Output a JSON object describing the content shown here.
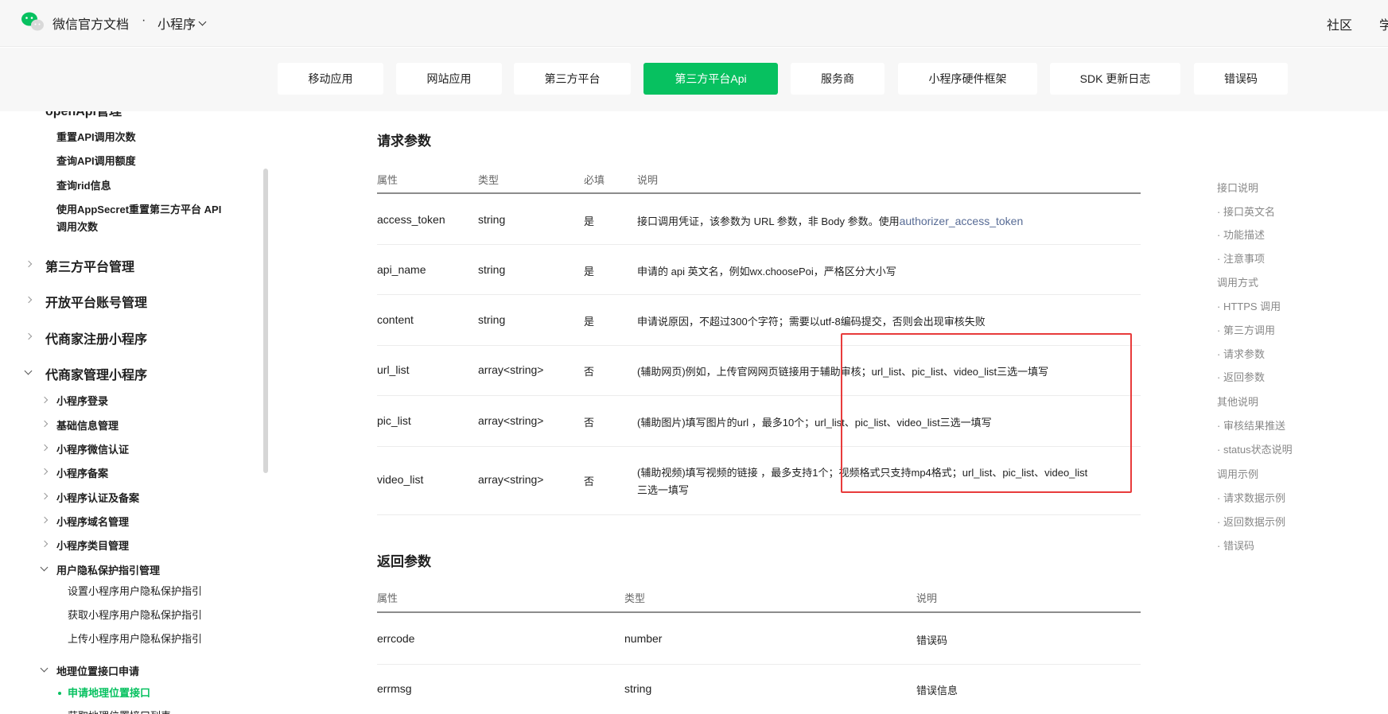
{
  "header": {
    "brand": "微信官方文档",
    "separator": "·",
    "product": "小程序",
    "right_links": [
      "社区",
      "学"
    ]
  },
  "subnav": {
    "items": [
      "移动应用",
      "网站应用",
      "第三方平台",
      "第三方平台Api",
      "服务商",
      "小程序硬件框架",
      "SDK 更新日志",
      "错误码"
    ],
    "active": "第三方平台Api"
  },
  "sidebar": {
    "partial_top": "openApi管理",
    "api_items": [
      "重置API调用次数",
      "查询API调用额度",
      "查询rid信息",
      "使用AppSecret重置第三方平台 API",
      "调用次数"
    ],
    "groups": [
      "第三方平台管理",
      "开放平台账号管理",
      "代商家注册小程序",
      "代商家管理小程序"
    ],
    "sub_items": [
      "小程序登录",
      "基础信息管理",
      "小程序微信认证",
      "小程序备案",
      "小程序认证及备案",
      "小程序域名管理",
      "小程序类目管理",
      "用户隐私保护指引管理"
    ],
    "privacy_items": [
      "设置小程序用户隐私保护指引",
      "获取小程序用户隐私保护指引",
      "上传小程序用户隐私保护指引"
    ],
    "geo_group": "地理位置接口申请",
    "geo_active": "申请地理位置接口",
    "geo_partial": "获取地理位置接口列表"
  },
  "request": {
    "title": "请求参数",
    "headers": [
      "属性",
      "类型",
      "必填",
      "说明"
    ],
    "rows": [
      {
        "name": "access_token",
        "type": "string",
        "required": "是",
        "desc": "接口调用凭证，该参数为 URL 参数，非 Body 参数。使用",
        "link": "authorizer_access_token"
      },
      {
        "name": "api_name",
        "type": "string",
        "required": "是",
        "desc": "申请的 api 英文名，例如wx.choosePoi，严格区分大小写"
      },
      {
        "name": "content",
        "type": "string",
        "required": "是",
        "desc": "申请说原因，不超过300个字符；需要以utf-8编码提交，否则会出现审核失败"
      },
      {
        "name": "url_list",
        "type": "array<string>",
        "required": "否",
        "desc": "(辅助网页)例如，上传官网网页链接用于辅助审核；url_list、pic_list、video_list三选一填写"
      },
      {
        "name": "pic_list",
        "type": "array<string>",
        "required": "否",
        "desc": "(辅助图片)填写图片的url ，最多10个；url_list、pic_list、video_list三选一填写"
      },
      {
        "name": "video_list",
        "type": "array<string>",
        "required": "否",
        "desc": "(辅助视频)填写视频的链接 ，最多支持1个；视频格式只支持mp4格式；url_list、pic_list、video_list",
        "desc2": "三选一填写"
      }
    ]
  },
  "response": {
    "title": "返回参数",
    "headers": [
      "属性",
      "类型",
      "说明"
    ],
    "rows": [
      {
        "name": "errcode",
        "type": "number",
        "desc": "错误码"
      },
      {
        "name": "errmsg",
        "type": "string",
        "desc": "错误信息"
      }
    ]
  },
  "toc": {
    "items": [
      "接口说明",
      "· 接口英文名",
      "· 功能描述",
      "· 注意事项",
      "调用方式",
      "· HTTPS 调用",
      "· 第三方调用",
      "· 请求参数",
      "· 返回参数",
      "其他说明",
      "· 审核结果推送",
      "· status状态说明",
      "调用示例",
      "· 请求数据示例",
      "· 返回数据示例",
      "· 错误码"
    ]
  },
  "colors": {
    "accent": "#07c160",
    "link": "#576b95",
    "highlight_box": "#e83b3b"
  }
}
